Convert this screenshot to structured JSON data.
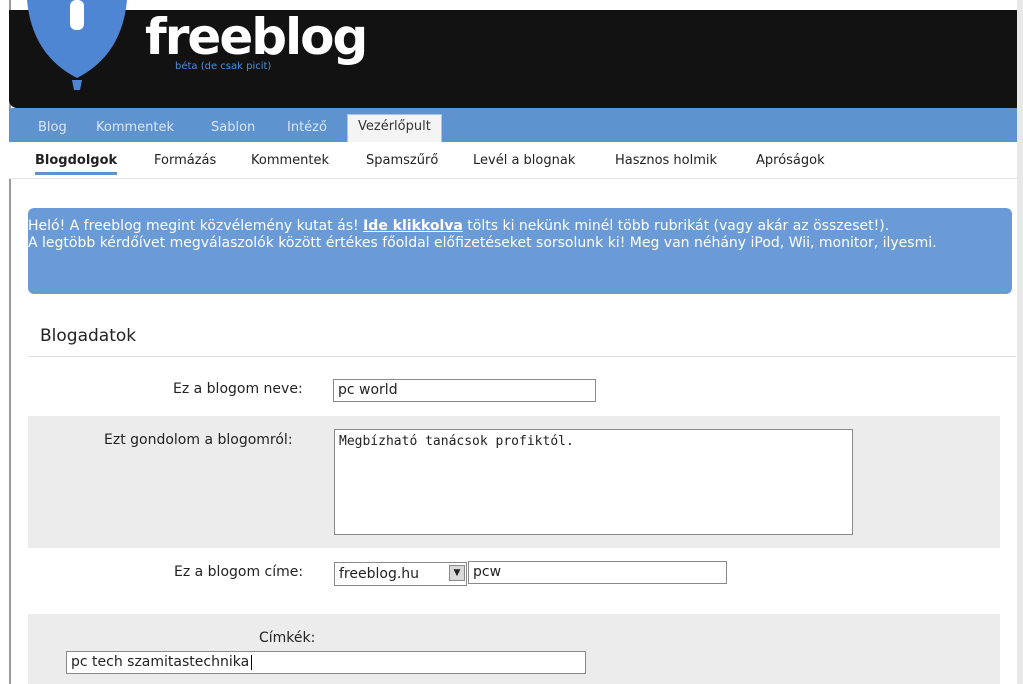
{
  "header": {
    "logo": "freeblog",
    "subtitle": "béta (de csak picit)"
  },
  "main_nav": {
    "items": [
      "Blog",
      "Kommentek",
      "Sablon",
      "Intéző"
    ],
    "active": "Vezérlőpult"
  },
  "sub_nav": {
    "items": [
      "Blogdolgok",
      "Formázás",
      "Kommentek",
      "Spamszűrő",
      "Levél a blognak",
      "Hasznos holmik",
      "Apróságok"
    ],
    "selected": "Blogdolgok"
  },
  "notice": {
    "text_before": "Heló! A freeblog megint közvélemény kutat ás! ",
    "link": "Ide klikkolva",
    "text_after": " tölts ki nekünk minél több rubrikát (vagy akár az összeset!).",
    "line2": "A legtöbb kérdőívet megválaszolók között értékes főoldal előfizetéseket sorsolunk ki! Meg van néhány iPod, Wii, monitor, ilyesmi."
  },
  "section": {
    "title": "Blogadatok"
  },
  "form": {
    "name_label": "Ez a blogom neve:",
    "name_value": "pc world",
    "about_label": "Ezt gondolom a blogomról:",
    "about_value": "Megbízható tanácsok profiktól.",
    "address_label": "Ez a blogom címe:",
    "domain_value": "freeblog.hu",
    "subdomain_value": "pcw",
    "tags_label": "Címkék:",
    "tags_value": "pc tech szamitastechnika"
  },
  "colors": {
    "nav_blue": "#5f93d0",
    "notice_blue": "#6a9bd6",
    "header_black": "#121212"
  }
}
